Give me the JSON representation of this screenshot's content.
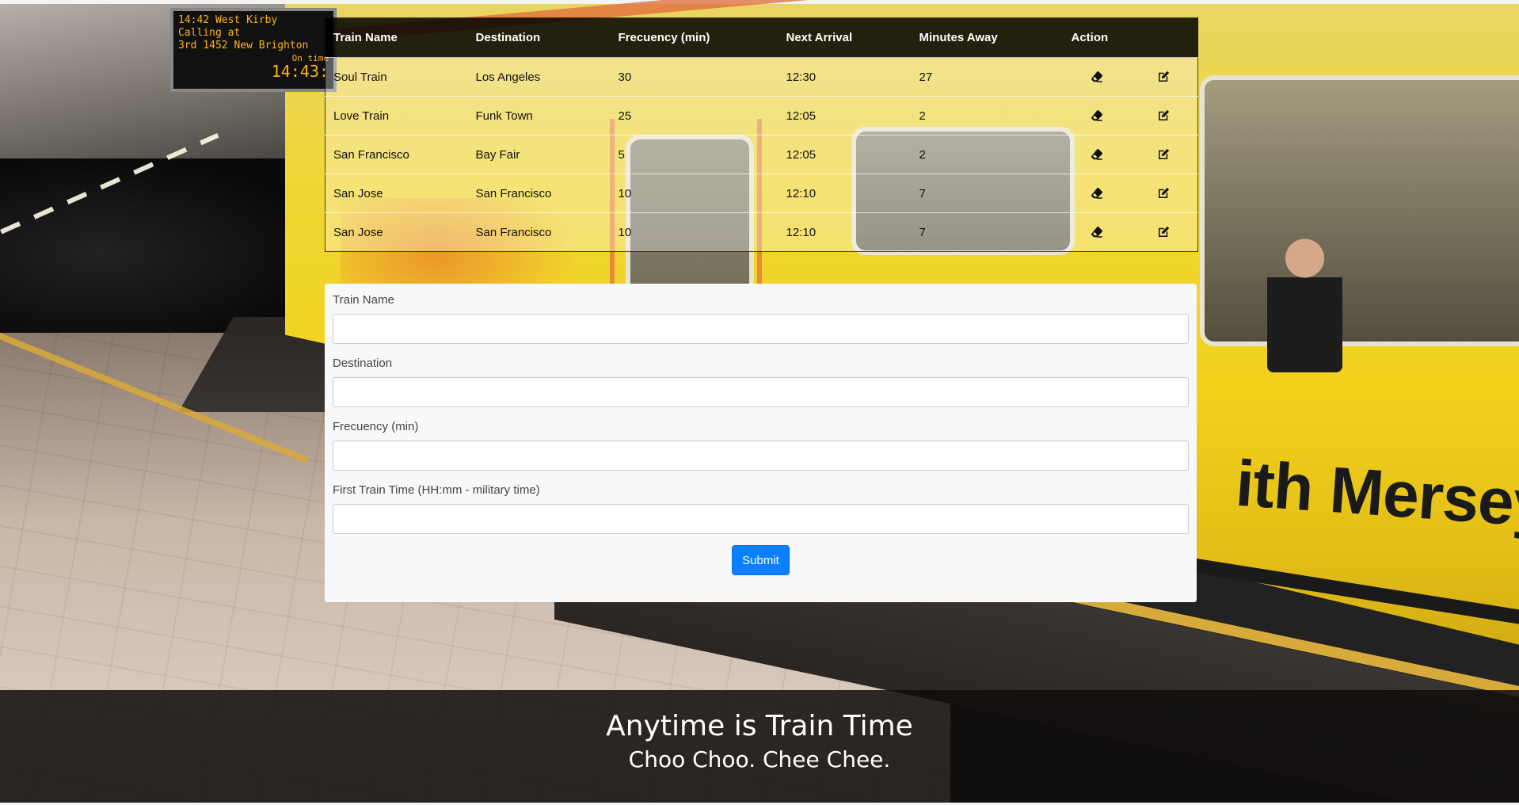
{
  "station_sign": {
    "line1": "14:42 West Kirby",
    "line2": "Calling at",
    "line3": "3rd 1452 New Brighton",
    "status": "On time",
    "clock": "14:43:"
  },
  "train_livery_text": "ith Merseyrc",
  "table": {
    "headers": {
      "train_name": "Train Name",
      "destination": "Destination",
      "frequency": "Frecuency (min)",
      "next_arrival": "Next Arrival",
      "minutes_away": "Minutes Away",
      "action": "Action"
    },
    "rows": [
      {
        "train_name": "Soul Train",
        "destination": "Los Angeles",
        "frequency": "30",
        "next_arrival": "12:30",
        "minutes_away": "27"
      },
      {
        "train_name": "Love Train",
        "destination": "Funk Town",
        "frequency": "25",
        "next_arrival": "12:05",
        "minutes_away": "2"
      },
      {
        "train_name": "San Francisco",
        "destination": "Bay Fair",
        "frequency": "5",
        "next_arrival": "12:05",
        "minutes_away": "2"
      },
      {
        "train_name": "San Jose",
        "destination": "San Francisco",
        "frequency": "10",
        "next_arrival": "12:10",
        "minutes_away": "7"
      },
      {
        "train_name": "San Jose",
        "destination": "San Francisco",
        "frequency": "10",
        "next_arrival": "12:10",
        "minutes_away": "7"
      }
    ],
    "action_icons": [
      "eraser-icon",
      "edit-icon"
    ]
  },
  "form": {
    "train_name_label": "Train Name",
    "train_name_value": "",
    "destination_label": "Destination",
    "destination_value": "",
    "frequency_label": "Frecuency (min)",
    "frequency_value": "",
    "first_time_label": "First Train Time (HH:mm - military time)",
    "first_time_value": "",
    "submit_label": "Submit"
  },
  "footer": {
    "title": "Anytime is Train Time",
    "subtitle": "Choo Choo. Chee Chee."
  },
  "colors": {
    "submit_button": "#0b80ff",
    "table_header_bg": "#000000",
    "footer_bg": "#0f0d0c",
    "sign_text": "#ffb21a",
    "train_yellow": "#f2d21d"
  }
}
